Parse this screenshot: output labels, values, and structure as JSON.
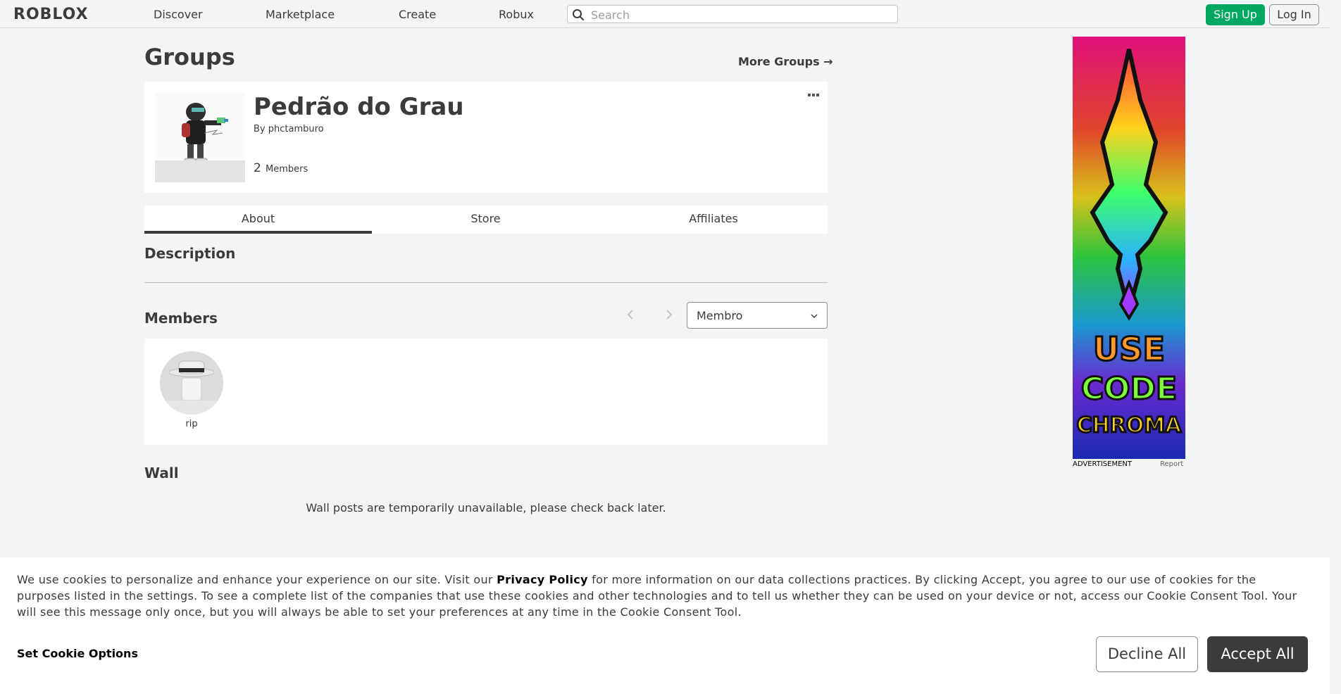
{
  "header": {
    "logo": "ROBLOX",
    "nav": [
      "Discover",
      "Marketplace",
      "Create",
      "Robux"
    ],
    "search_placeholder": "Search",
    "signup_label": "Sign Up",
    "login_label": "Log In"
  },
  "page": {
    "title": "Groups",
    "more_groups": "More Groups →"
  },
  "group": {
    "name": "Pedrão do Grau",
    "by_prefix": "By",
    "owner": "phctamburo",
    "member_count": "2",
    "members_label": "Members"
  },
  "tabs": [
    {
      "label": "About",
      "active": true
    },
    {
      "label": "Store",
      "active": false
    },
    {
      "label": "Affiliates",
      "active": false
    }
  ],
  "sections": {
    "description": "Description",
    "members": "Members",
    "wall": "Wall"
  },
  "members": {
    "role_selected": "Membro",
    "list": [
      {
        "name": "rip"
      }
    ]
  },
  "wall": {
    "message": "Wall posts are temporarily unavailable, please check back later."
  },
  "ad": {
    "label": "ADVERTISEMENT",
    "report": "Report",
    "line1": "USE",
    "line2": "CODE",
    "line3": "CHROMA"
  },
  "cookie": {
    "text_1": "We use cookies to personalize and enhance your experience on our site. Visit our ",
    "privacy_link": "Privacy Policy",
    "text_2": " for more information on our data collections practices. By clicking Accept, you agree to our use of cookies for the purposes listed in the settings. To see a complete list of the companies that use these cookies and other technologies and to tell us whether they can be used on your device or not, access our Cookie Consent Tool. Your will see this message only once, but you will always be able to set your preferences at any time in the Cookie Consent Tool.",
    "set_options": "Set Cookie Options",
    "decline": "Decline All",
    "accept": "Accept All"
  },
  "colors": {
    "signup_green": "#00a862",
    "accept_dark": "#393b3d",
    "page_bg": "#f2f4f5"
  }
}
